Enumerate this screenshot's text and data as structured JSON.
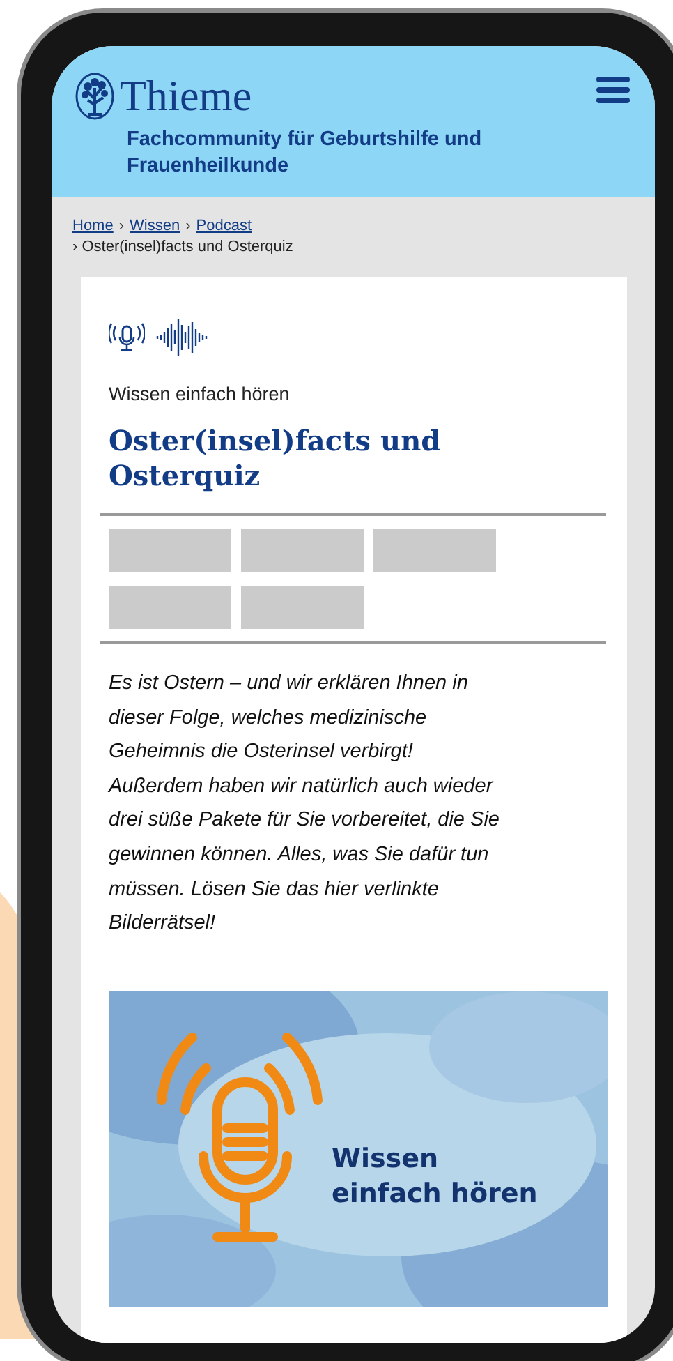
{
  "header": {
    "logo": "Thieme",
    "subtitle": "Fachcommunity für Geburtshilfe und Frauenheilkunde"
  },
  "breadcrumb": {
    "links": [
      "Home",
      "Wissen",
      "Podcast"
    ],
    "separator": "›",
    "current": "Oster(insel)facts und Osterquiz"
  },
  "article": {
    "kicker": "Wissen einfach hören",
    "title": "Oster(insel)facts und Osterquiz",
    "body": "Es ist Ostern – und wir erklären Ihnen in dieser Folge, welches medizinische Geheimnis die Osterinsel verbirgt! Außerdem haben wir natürlich auch wieder drei süße Pakete für Sie vorbereitet, die Sie gewinnen können. Alles, was Sie dafür tun müssen. Lösen Sie das hier verlinkte Bilderrätsel!",
    "banner": {
      "line_1": "Wissen",
      "line_2": "einfach hören"
    }
  }
}
